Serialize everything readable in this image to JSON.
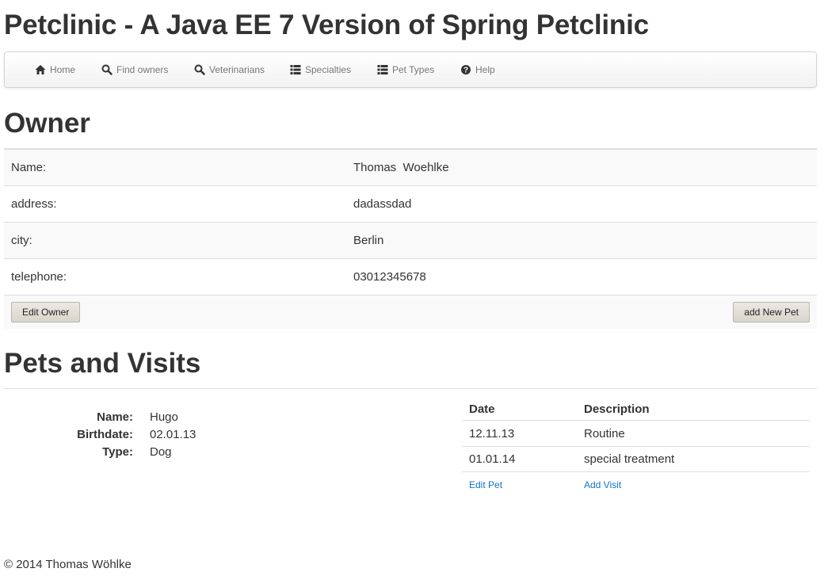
{
  "app": {
    "title": "Petclinic - A Java EE 7 Version of Spring Petclinic"
  },
  "nav": {
    "items": [
      {
        "label": "Home",
        "icon": "home-icon"
      },
      {
        "label": "Find owners",
        "icon": "search-icon"
      },
      {
        "label": "Veterinarians",
        "icon": "search-icon"
      },
      {
        "label": "Specialties",
        "icon": "list-icon"
      },
      {
        "label": "Pet Types",
        "icon": "list-icon"
      },
      {
        "label": "Help",
        "icon": "help-icon"
      }
    ]
  },
  "owner": {
    "heading": "Owner",
    "rows": [
      {
        "label": "Name:",
        "value": "Thomas  Woehlke"
      },
      {
        "label": "address:",
        "value": "dadassdad"
      },
      {
        "label": "city:",
        "value": "Berlin"
      },
      {
        "label": "telephone:",
        "value": "03012345678"
      }
    ],
    "edit_button": "Edit Owner",
    "add_pet_button": "add New Pet"
  },
  "pets": {
    "heading": "Pets and Visits",
    "pet": {
      "fields": [
        {
          "label": "Name:",
          "value": "Hugo"
        },
        {
          "label": "Birthdate:",
          "value": "02.01.13"
        },
        {
          "label": "Type:",
          "value": "Dog"
        }
      ]
    },
    "visits": {
      "headers": [
        "Date",
        "Description"
      ],
      "rows": [
        {
          "date": "12.11.13",
          "description": "Routine"
        },
        {
          "date": "01.01.14",
          "description": "special treatment"
        }
      ],
      "edit_pet_link": "Edit Pet",
      "add_visit_link": "Add Visit"
    }
  },
  "footer": {
    "text": "© 2014 Thomas Wöhlke"
  },
  "colors": {
    "link": "#0e74c9",
    "text": "#333333",
    "nav_text": "#777777"
  }
}
